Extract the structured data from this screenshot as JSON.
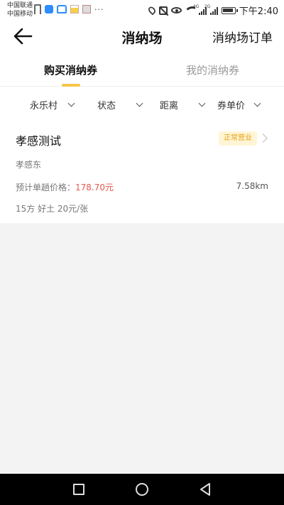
{
  "status_bar": {
    "carrier_1": "中国联通",
    "carrier_2": "中国移动",
    "more": "···",
    "time": "下午2:40",
    "signal_1_label": "4G",
    "signal_2_label": "2G"
  },
  "nav": {
    "title": "消纳场",
    "right_link": "消纳场订单"
  },
  "tabs": {
    "active": "购买消纳券",
    "inactive": "我的消纳券",
    "accent": "#f6c64a"
  },
  "filters": [
    "永乐村",
    "状态",
    "距离",
    "券单价"
  ],
  "card": {
    "title": "孝感测试",
    "badge": "正常营业",
    "address": "孝感东",
    "price_label": "预计单趟价格：",
    "price_value": "178.70元",
    "distance": "7.58km",
    "description": "15方 好土 20元/张",
    "price_color": "#e8594f",
    "badge_color": "#e6a10f"
  },
  "icons": {
    "back": "arrow-left-icon",
    "chevron": "chevron-down-icon",
    "arrow": "chevron-right-icon"
  }
}
